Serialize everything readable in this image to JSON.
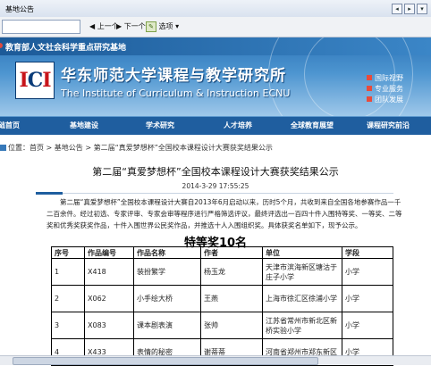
{
  "browser": {
    "tab_title": "基地公告",
    "tab_buttons": [
      "◂",
      "▸",
      "▾"
    ],
    "find_prev": "上一个",
    "find_next": "下一个",
    "find_options": "选项",
    "find_options_arrow": "▾"
  },
  "banner": {
    "top_strip": "教育部人文社会科学重点研究基地",
    "logo_a": "I",
    "logo_b": "C",
    "logo_c": "I",
    "cn_title": "华东师范大学课程与教学研究所",
    "en_title": "The Institute of Curriculum & Instruction  ECNU",
    "quick_links": [
      "国际视野",
      "专业服务",
      "团队发展"
    ]
  },
  "nav": [
    "础首页",
    "基地建设",
    "学术研究",
    "人才培养",
    "全球教育展望",
    "课程研究前沿"
  ],
  "breadcrumb": {
    "prefix": "位置：",
    "home": "首页",
    "sep": " > ",
    "section": "基地公告",
    "current": "第二届“真爱梦想杯”全国校本课程设计大赛获奖结果公示"
  },
  "article": {
    "title": "第二届“真爱梦想杯”全国校本课程设计大赛获奖结果公示",
    "date": "2014-3-29 17:55:25",
    "body": "第二届“真爱梦想杯”全国校本课程设计大赛自2013年6月启动以来，历时5个月，共收到来自全国各地参赛作品一千二百余件。经过初选、专家评审、专家会审等程序进行严格筛选评议，最终评选出一百四十件入围特等奖、一等奖、二等奖和优秀奖获奖作品，十件入围世界公民奖作品，并推选十人入围组织奖。具体获奖名单如下，现予公示。",
    "section_title": "特等奖10名"
  },
  "table": {
    "headers": [
      "序号",
      "作品编号",
      "作品名称",
      "作者",
      "单位",
      "学段"
    ],
    "rows": [
      [
        "1",
        "X418",
        "装扮繁学",
        "杨玉龙",
        "天津市滨海新区塘沽于庄子小学",
        "小学"
      ],
      [
        "2",
        "X062",
        "小手绘大桥",
        "王燕",
        "上海市徐汇区徐浦小学",
        "小学"
      ],
      [
        "3",
        "X083",
        "课本剧表演",
        "张帅",
        "江苏省常州市新北区新桥实验小学",
        "小学"
      ],
      [
        "4",
        "X433",
        "表情的秘密",
        "谢蒂蒂",
        "河南省郑州市郑东新区",
        "小学"
      ]
    ]
  },
  "colors": {
    "nav_bg": "#1f5e9f",
    "banner_top": "#2d74b8",
    "accent_red": "#c8151b"
  }
}
